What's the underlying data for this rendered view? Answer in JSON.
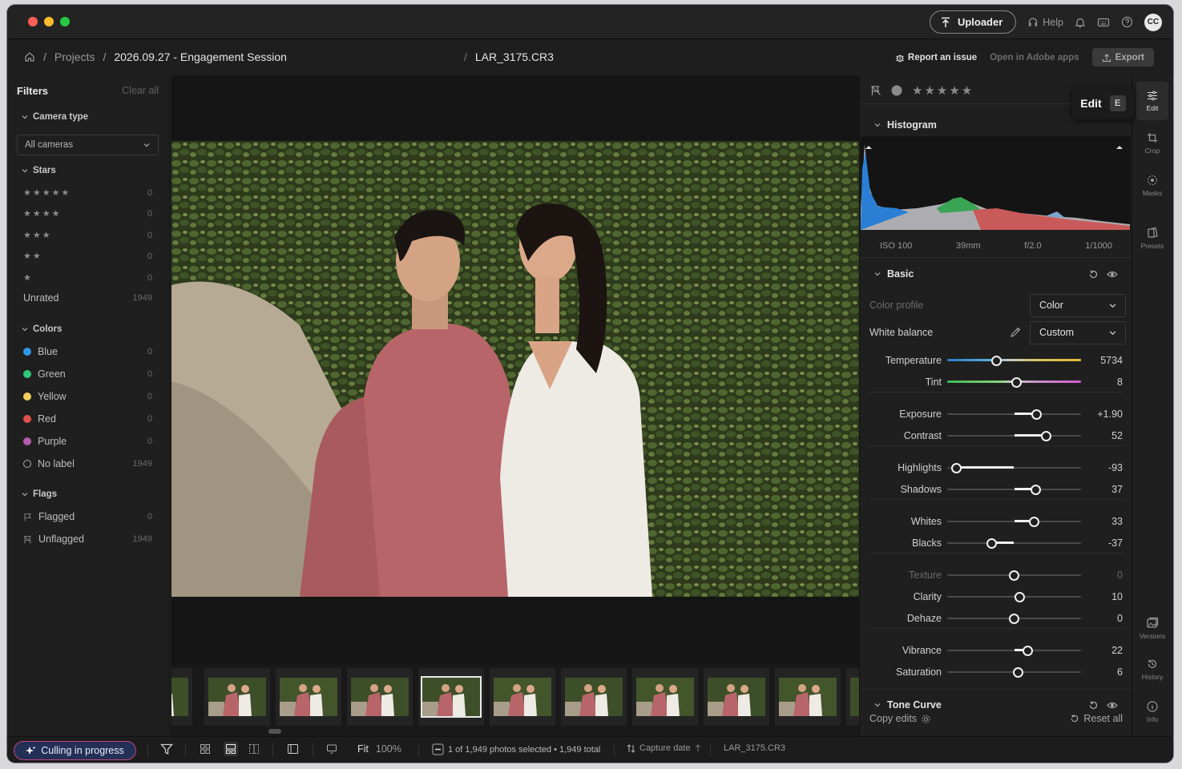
{
  "titlebar": {
    "uploader_label": "Uploader",
    "help_label": "Help",
    "avatar_initials": "CC"
  },
  "breadcrumb": {
    "projects": "Projects",
    "project": "2026.09.27 - Engagement Session",
    "file": "LAR_3175.CR3",
    "report": "Report an issue",
    "open_adobe": "Open in Adobe apps",
    "export": "Export"
  },
  "filters": {
    "title": "Filters",
    "clear": "Clear all",
    "camera_type": {
      "label": "Camera type",
      "value": "All cameras"
    },
    "stars": {
      "label": "Stars",
      "rows": [
        {
          "stars": "★★★★★",
          "count": "0"
        },
        {
          "stars": "★★★★",
          "count": "0"
        },
        {
          "stars": "★★★",
          "count": "0"
        },
        {
          "stars": "★★",
          "count": "0"
        },
        {
          "stars": "★",
          "count": "0"
        },
        {
          "stars": "Unrated",
          "count": "1949"
        }
      ]
    },
    "colors": {
      "label": "Colors",
      "rows": [
        {
          "name": "Blue",
          "count": "0",
          "color": "#2f9ae8"
        },
        {
          "name": "Green",
          "count": "0",
          "color": "#2ec97a"
        },
        {
          "name": "Yellow",
          "count": "0",
          "color": "#f2cf5b"
        },
        {
          "name": "Red",
          "count": "0",
          "color": "#e0504a"
        },
        {
          "name": "Purple",
          "count": "0",
          "color": "#b45aa8"
        },
        {
          "name": "No label",
          "count": "1949",
          "color": "none"
        }
      ]
    },
    "flags": {
      "label": "Flags",
      "rows": [
        {
          "name": "Flagged",
          "count": "0"
        },
        {
          "name": "Unflagged",
          "count": "1949"
        }
      ]
    }
  },
  "panel": {
    "rating_stars": "★★★★★",
    "tooltip_label": "Edit",
    "tooltip_key": "E",
    "histogram_label": "Histogram",
    "exif": {
      "iso": "ISO 100",
      "focal": "39mm",
      "aperture": "f/2.0",
      "shutter": "1/1000"
    },
    "basic_label": "Basic",
    "color_profile": {
      "label": "Color profile",
      "value": "Color"
    },
    "white_balance": {
      "label": "White balance",
      "value": "Custom"
    },
    "sliders": [
      {
        "label": "Temperature",
        "value": "5734",
        "level": 0.37
      },
      {
        "label": "Tint",
        "value": "8",
        "level": 0.52
      },
      {
        "label": "Exposure",
        "value": "+1.90",
        "level": 0.67
      },
      {
        "label": "Contrast",
        "value": "52",
        "level": 0.74
      },
      {
        "label": "Highlights",
        "value": "-93",
        "level": 0.07
      },
      {
        "label": "Shadows",
        "value": "37",
        "level": 0.66
      },
      {
        "label": "Whites",
        "value": "33",
        "level": 0.65
      },
      {
        "label": "Blacks",
        "value": "-37",
        "level": 0.33
      },
      {
        "label": "Texture",
        "value": "0",
        "level": 0.5
      },
      {
        "label": "Clarity",
        "value": "10",
        "level": 0.54
      },
      {
        "label": "Dehaze",
        "value": "0",
        "level": 0.5
      },
      {
        "label": "Vibrance",
        "value": "22",
        "level": 0.6
      },
      {
        "label": "Saturation",
        "value": "6",
        "level": 0.53
      }
    ],
    "tone_curve_label": "Tone Curve",
    "copy_edits": "Copy edits",
    "reset_all": "Reset all"
  },
  "sidetabs": {
    "edit": "Edit",
    "crop": "Crop",
    "masks": "Masks",
    "presets": "Presets",
    "versions": "Versions",
    "history": "History",
    "info": "Info"
  },
  "statusbar": {
    "culling": "Culling in progress",
    "fit": "Fit",
    "zoom": "100%",
    "selection": "1 of 1,949 photos selected • 1,949 total",
    "sort": "Capture date",
    "filename": "LAR_3175.CR3"
  }
}
